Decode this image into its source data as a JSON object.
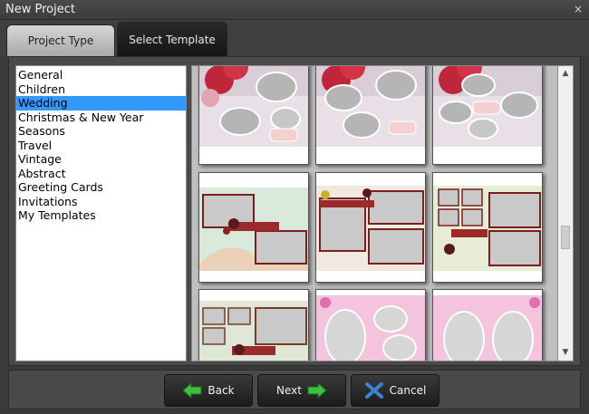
{
  "window": {
    "title": "New Project",
    "close_glyph": "×"
  },
  "tabs": [
    {
      "label": "Project Type",
      "active": false
    },
    {
      "label": "Select Template",
      "active": true
    }
  ],
  "categories": [
    "General",
    "Children",
    "Wedding",
    "Christmas & New Year",
    "Seasons",
    "Travel",
    "Vintage",
    "Abstract",
    "Greeting Cards",
    "Invitations",
    "My Templates"
  ],
  "selected_category": "Wedding",
  "templates": [
    {
      "style": "roses-bubbles"
    },
    {
      "style": "roses-bubbles"
    },
    {
      "style": "roses-bubbles"
    },
    {
      "style": "floral-frames"
    },
    {
      "style": "floral-frames"
    },
    {
      "style": "floral-frames"
    },
    {
      "style": "collage-grid"
    },
    {
      "style": "pink-ovals"
    },
    {
      "style": "pink-ovals"
    }
  ],
  "scrollbar": {
    "up_glyph": "▲",
    "down_glyph": "▼"
  },
  "buttons": {
    "back": "Back",
    "next": "Next",
    "cancel": "Cancel"
  },
  "colors": {
    "selection": "#3399ff",
    "arrow_green": "#3fbf3f",
    "cancel_blue": "#3b82d6"
  },
  "icons": {
    "back": "arrow-left-icon",
    "next": "arrow-right-icon",
    "cancel": "x-icon",
    "close": "close-icon"
  }
}
